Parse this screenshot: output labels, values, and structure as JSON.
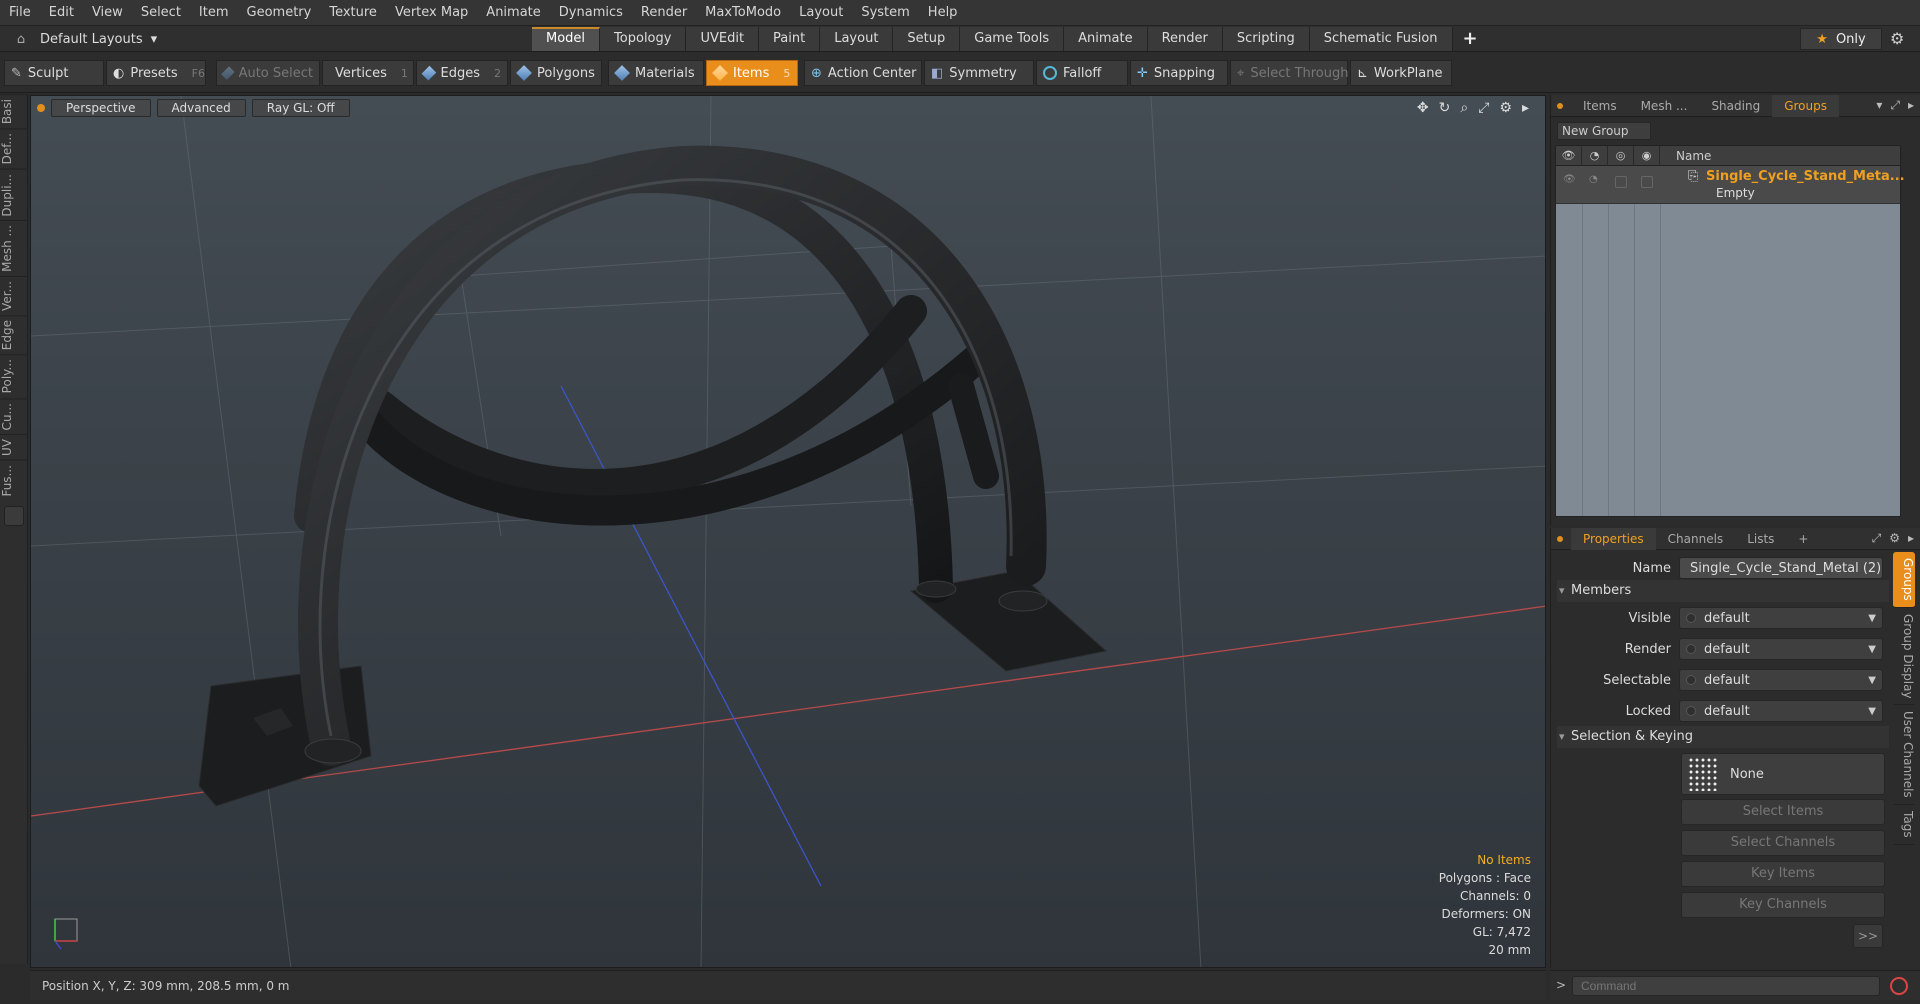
{
  "menu": [
    "File",
    "Edit",
    "View",
    "Select",
    "Item",
    "Geometry",
    "Texture",
    "Vertex Map",
    "Animate",
    "Dynamics",
    "Render",
    "MaxToModo",
    "Layout",
    "System",
    "Help"
  ],
  "layout_selector": "Default Layouts",
  "mode_tabs": [
    "Model",
    "Topology",
    "UVEdit",
    "Paint",
    "Layout",
    "Setup",
    "Game Tools",
    "Animate",
    "Render",
    "Scripting",
    "Schematic Fusion"
  ],
  "active_mode_tab": "Model",
  "only_label": "Only",
  "toolbar": {
    "sculpt": "Sculpt",
    "presets": "Presets",
    "presets_key": "F6",
    "auto_select": "Auto Select",
    "vertices": "Vertices",
    "vertices_key": "1",
    "edges": "Edges",
    "edges_key": "2",
    "polygons": "Polygons",
    "materials": "Materials",
    "items": "Items",
    "items_key": "5",
    "action_center": "Action Center",
    "symmetry": "Symmetry",
    "falloff": "Falloff",
    "snapping": "Snapping",
    "select_through": "Select Through",
    "workplane": "WorkPlane"
  },
  "left_tabs": [
    "Basi",
    "Def...",
    "Dupli...",
    "Mesh ...",
    "Ver...",
    "Edge",
    "Poly...",
    "Cu...",
    "UV",
    "Fus..."
  ],
  "viewport": {
    "view": "Perspective",
    "shading": "Advanced",
    "raygl": "Ray GL: Off",
    "stats": {
      "items": "No Items",
      "polygons": "Polygons : Face",
      "channels": "Channels: 0",
      "deformers": "Deformers: ON",
      "gl": "GL: 7,472",
      "grid": "20 mm"
    }
  },
  "status": "Position X, Y, Z:  309 mm, 208.5 mm, 0 m",
  "panel_tabs": [
    "Items",
    "Mesh ...",
    "Shading",
    "Groups"
  ],
  "active_panel_tab": "Groups",
  "groups": {
    "new_group": "New Group",
    "name_header": "Name",
    "row_title": "Single_Cycle_Stand_Meta...",
    "row_sub": "Empty"
  },
  "props_tabs": [
    "Properties",
    "Channels",
    "Lists"
  ],
  "active_props_tab": "Properties",
  "properties": {
    "name_label": "Name",
    "name_value": "Single_Cycle_Stand_Metal (2)",
    "members_header": "Members",
    "visible_label": "Visible",
    "visible_value": "default",
    "render_label": "Render",
    "render_value": "default",
    "selectable_label": "Selectable",
    "selectable_value": "default",
    "locked_label": "Locked",
    "locked_value": "default",
    "selkey_header": "Selection & Keying",
    "none_label": "None",
    "select_items": "Select Items",
    "select_channels": "Select Channels",
    "key_items": "Key Items",
    "key_channels": "Key Channels",
    "more": ">>"
  },
  "right_vtabs": [
    "Groups",
    "Group Display",
    "User Channels",
    "Tags"
  ],
  "command_placeholder": "Command",
  "colors": {
    "accent": "#e98d1b",
    "highlight_text": "#f0a020"
  }
}
